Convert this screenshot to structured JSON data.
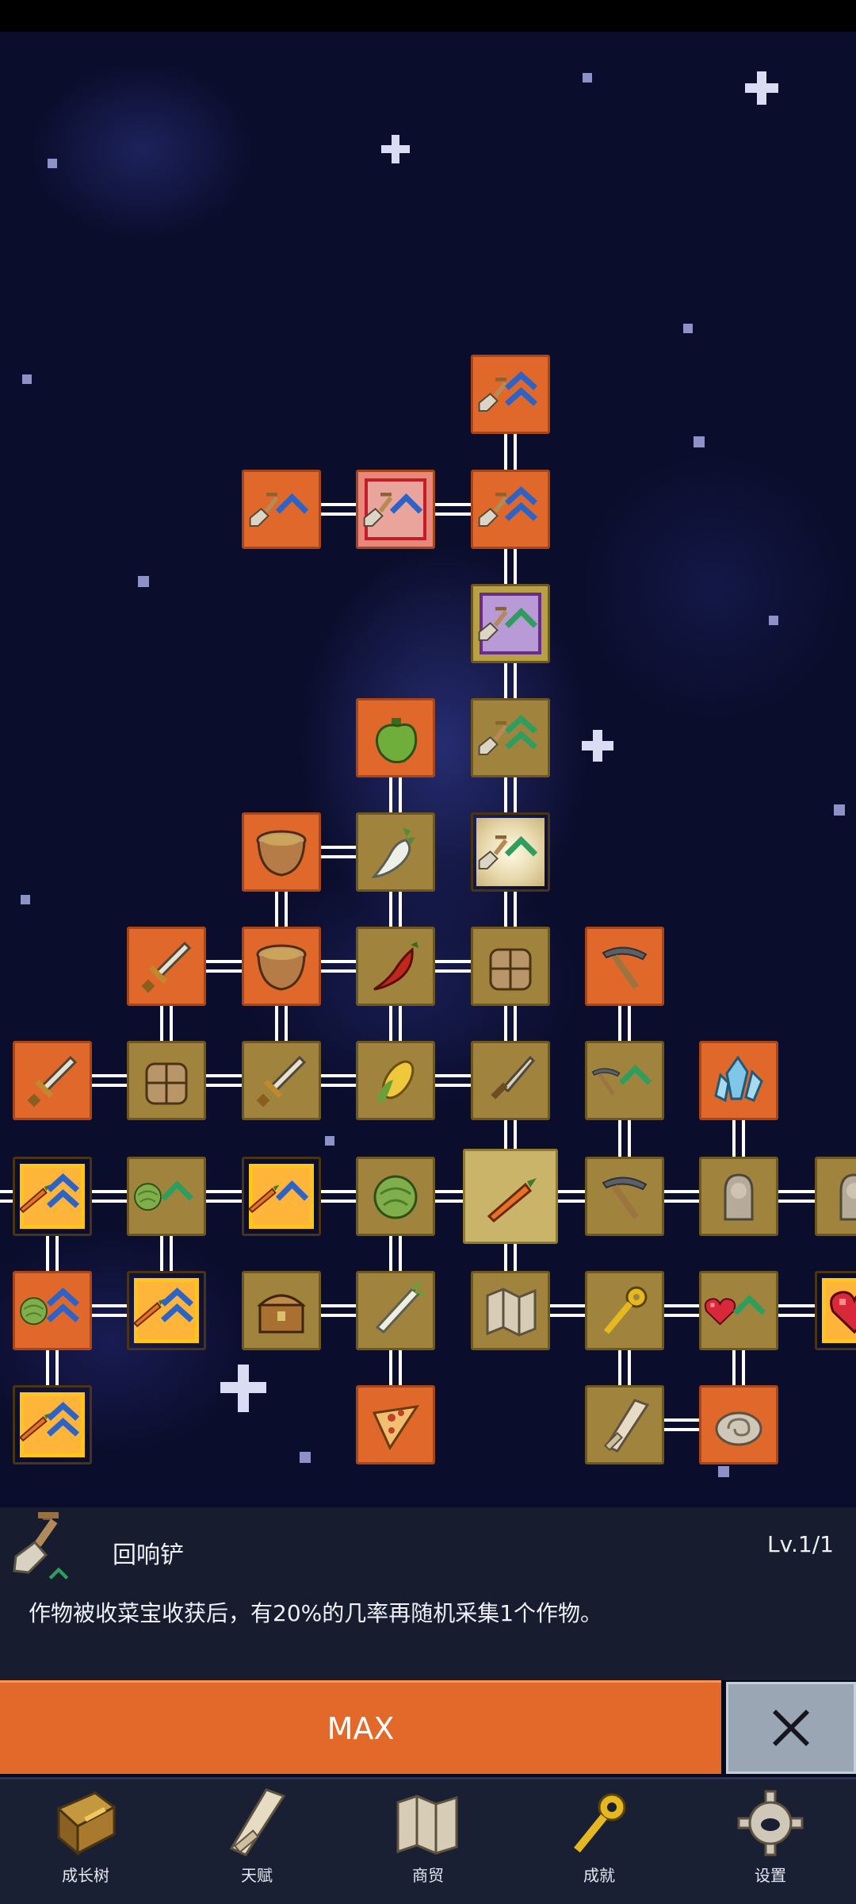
{
  "detail": {
    "skill_name": "回响铲",
    "level": "Lv.1/1",
    "description": "作物被收菜宝收获后，有20%的几率再随机采集1个作物。",
    "icon": "shovel-icon"
  },
  "actions": {
    "max_label": "MAX",
    "close_icon": "close-icon"
  },
  "bottom_nav": [
    {
      "label": "成长树",
      "icon": "book-icon"
    },
    {
      "label": "天赋",
      "icon": "scroll-icon"
    },
    {
      "label": "商贸",
      "icon": "map-icon"
    },
    {
      "label": "成就",
      "icon": "key-icon"
    },
    {
      "label": "设置",
      "icon": "gear-icon"
    }
  ],
  "skill_tree_nodes": [
    {
      "icon": "shovel-icon",
      "upgrade": "double-up"
    },
    {
      "icon": "shovel-icon",
      "upgrade": "single-up"
    },
    {
      "icon": "shovel-icon",
      "upgrade": "single-up",
      "state": "red-framed"
    },
    {
      "icon": "shovel-icon",
      "upgrade": "double-up"
    },
    {
      "icon": "shovel-icon",
      "upgrade": "single-up",
      "state": "purple-framed"
    },
    {
      "icon": "pepper-icon"
    },
    {
      "icon": "shovel-icon",
      "upgrade": "double-up"
    },
    {
      "icon": "bowl-icon"
    },
    {
      "icon": "radish-icon"
    },
    {
      "icon": "shovel-icon",
      "upgrade": "single-up",
      "state": "glowing"
    },
    {
      "icon": "sword-icon"
    },
    {
      "icon": "bowl-icon"
    },
    {
      "icon": "chili-icon"
    },
    {
      "icon": "backpack-icon"
    },
    {
      "icon": "pickaxe-icon"
    },
    {
      "icon": "sword-icon"
    },
    {
      "icon": "backpack-icon"
    },
    {
      "icon": "sword-icon"
    },
    {
      "icon": "corn-icon"
    },
    {
      "icon": "dagger-icon"
    },
    {
      "icon": "pickaxe-icon",
      "upgrade": "single-up"
    },
    {
      "icon": "crystal-icon"
    },
    {
      "icon": "carrot-icon",
      "upgrade": "double-up"
    },
    {
      "icon": "cabbage-icon",
      "upgrade": "single-up"
    },
    {
      "icon": "carrot-icon",
      "upgrade": "single-up"
    },
    {
      "icon": "cabbage-icon"
    },
    {
      "icon": "carrot-icon",
      "state": "selected"
    },
    {
      "icon": "pickaxe-icon"
    },
    {
      "icon": "statue-icon"
    },
    {
      "icon": "statue-icon"
    },
    {
      "icon": "cabbage-icon",
      "upgrade": "double-up"
    },
    {
      "icon": "carrot-icon",
      "upgrade": "double-up"
    },
    {
      "icon": "chest-icon"
    },
    {
      "icon": "leek-icon"
    },
    {
      "icon": "map-icon"
    },
    {
      "icon": "key-icon"
    },
    {
      "icon": "heart-icon",
      "upgrade": "single-up"
    },
    {
      "icon": "heart-icon"
    },
    {
      "icon": "carrot-icon",
      "upgrade": "double-up"
    },
    {
      "icon": "pizza-icon"
    },
    {
      "icon": "scroll-icon"
    },
    {
      "icon": "fossil-icon"
    }
  ]
}
